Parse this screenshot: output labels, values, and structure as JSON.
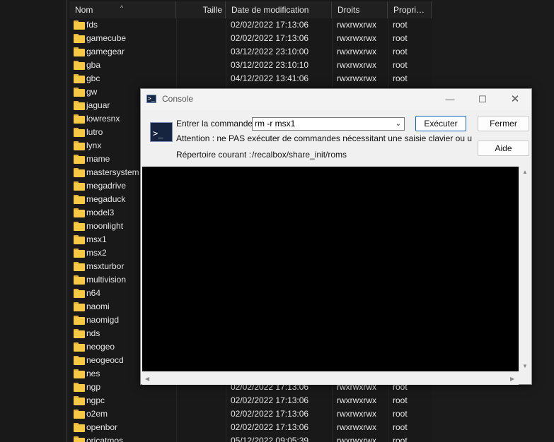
{
  "file_list": {
    "columns": [
      "Nom",
      "Taille",
      "Date de modification",
      "Droits",
      "Propriétaire"
    ],
    "rows": [
      {
        "name": "fds",
        "date": "02/02/2022 17:13:06",
        "rights": "rwxrwxrwx",
        "owner": "root"
      },
      {
        "name": "gamecube",
        "date": "02/02/2022 17:13:06",
        "rights": "rwxrwxrwx",
        "owner": "root"
      },
      {
        "name": "gamegear",
        "date": "03/12/2022 23:10:00",
        "rights": "rwxrwxrwx",
        "owner": "root"
      },
      {
        "name": "gba",
        "date": "03/12/2022 23:10:10",
        "rights": "rwxrwxrwx",
        "owner": "root"
      },
      {
        "name": "gbc",
        "date": "04/12/2022 13:41:06",
        "rights": "rwxrwxrwx",
        "owner": "root"
      },
      {
        "name": "gw",
        "date": "",
        "rights": "",
        "owner": ""
      },
      {
        "name": "jaguar",
        "date": "",
        "rights": "",
        "owner": ""
      },
      {
        "name": "lowresnx",
        "date": "",
        "rights": "",
        "owner": ""
      },
      {
        "name": "lutro",
        "date": "",
        "rights": "",
        "owner": ""
      },
      {
        "name": "lynx",
        "date": "",
        "rights": "",
        "owner": ""
      },
      {
        "name": "mame",
        "date": "",
        "rights": "",
        "owner": ""
      },
      {
        "name": "mastersystem",
        "date": "",
        "rights": "",
        "owner": ""
      },
      {
        "name": "megadrive",
        "date": "",
        "rights": "",
        "owner": ""
      },
      {
        "name": "megaduck",
        "date": "",
        "rights": "",
        "owner": ""
      },
      {
        "name": "model3",
        "date": "",
        "rights": "",
        "owner": ""
      },
      {
        "name": "moonlight",
        "date": "",
        "rights": "",
        "owner": ""
      },
      {
        "name": "msx1",
        "date": "",
        "rights": "",
        "owner": ""
      },
      {
        "name": "msx2",
        "date": "",
        "rights": "",
        "owner": ""
      },
      {
        "name": "msxturbor",
        "date": "",
        "rights": "",
        "owner": ""
      },
      {
        "name": "multivision",
        "date": "",
        "rights": "",
        "owner": ""
      },
      {
        "name": "n64",
        "date": "",
        "rights": "",
        "owner": ""
      },
      {
        "name": "naomi",
        "date": "",
        "rights": "",
        "owner": ""
      },
      {
        "name": "naomigd",
        "date": "",
        "rights": "",
        "owner": ""
      },
      {
        "name": "nds",
        "date": "",
        "rights": "",
        "owner": ""
      },
      {
        "name": "neogeo",
        "date": "",
        "rights": "",
        "owner": ""
      },
      {
        "name": "neogeocd",
        "date": "",
        "rights": "",
        "owner": ""
      },
      {
        "name": "nes",
        "date": "",
        "rights": "",
        "owner": ""
      },
      {
        "name": "ngp",
        "date": "02/02/2022 17:13:06",
        "rights": "rwxrwxrwx",
        "owner": "root"
      },
      {
        "name": "ngpc",
        "date": "02/02/2022 17:13:06",
        "rights": "rwxrwxrwx",
        "owner": "root"
      },
      {
        "name": "o2em",
        "date": "02/02/2022 17:13:06",
        "rights": "rwxrwxrwx",
        "owner": "root"
      },
      {
        "name": "openbor",
        "date": "02/02/2022 17:13:06",
        "rights": "rwxrwxrwx",
        "owner": "root"
      },
      {
        "name": "oricatmos",
        "date": "05/12/2022 09:05:39",
        "rights": "rwxrwxrwx",
        "owner": "root"
      }
    ]
  },
  "console": {
    "title": "Console",
    "command_label": "Entrer la commande",
    "command_value": "rm -r msx1",
    "execute_label": "Exécuter",
    "close_label": "Fermer",
    "help_label": "Aide",
    "warning": "Attention : ne PAS exécuter de commandes nécessitant une saisie clavier ou un transfert",
    "current_dir_label": "Répertoire courant :",
    "current_dir_value": "/recalbox/share_init/roms"
  }
}
